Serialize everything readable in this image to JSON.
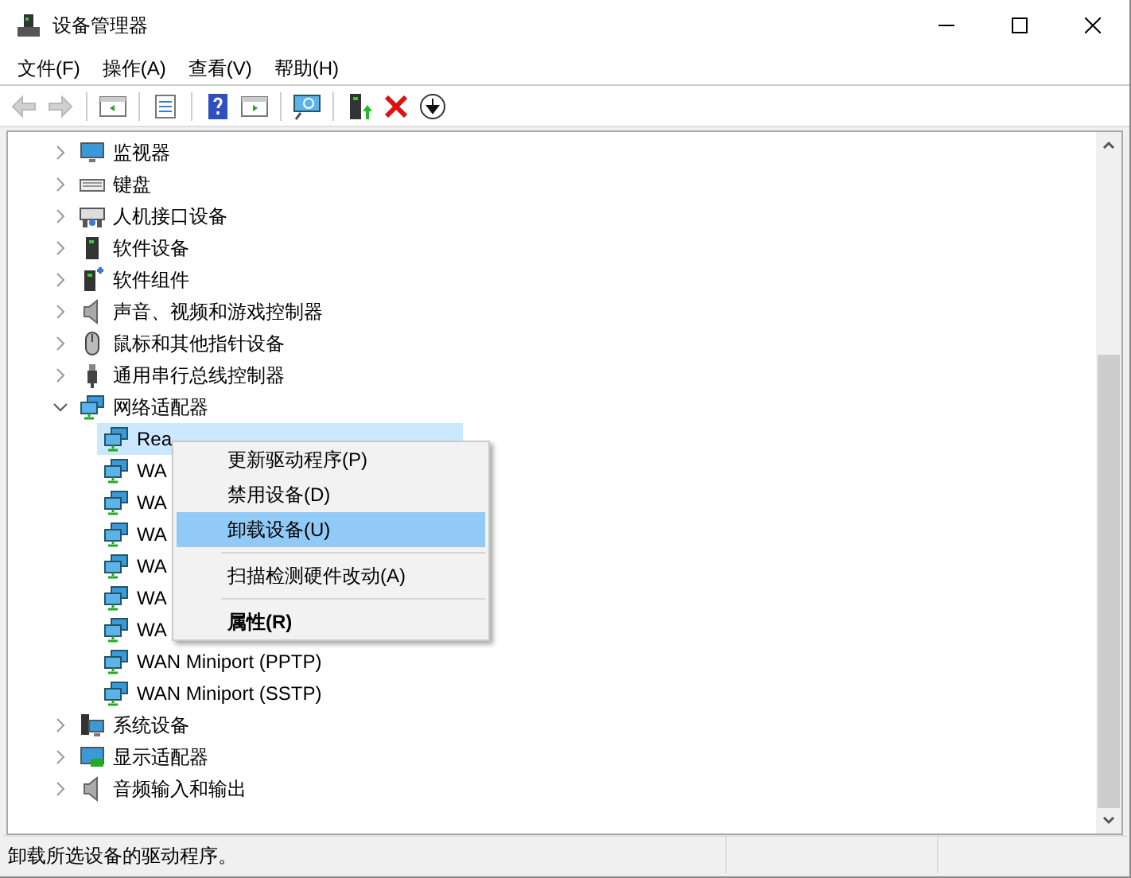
{
  "window": {
    "title": "设备管理器",
    "controls": [
      {
        "kind": "minimize"
      },
      {
        "kind": "maximize"
      },
      {
        "kind": "close"
      }
    ]
  },
  "menu_bar": [
    "文件(F)",
    "操作(A)",
    "查看(V)",
    "帮助(H)"
  ],
  "toolbar": [
    {
      "kind": "back",
      "disabled": true
    },
    {
      "kind": "forward",
      "disabled": true
    },
    {
      "kind": "sep"
    },
    {
      "kind": "panel",
      "disabled": false
    },
    {
      "kind": "sep"
    },
    {
      "kind": "properties",
      "disabled": false
    },
    {
      "kind": "sep"
    },
    {
      "kind": "help",
      "disabled": false
    },
    {
      "kind": "panel2",
      "disabled": false
    },
    {
      "kind": "sep"
    },
    {
      "kind": "scan",
      "disabled": false
    },
    {
      "kind": "sep"
    },
    {
      "kind": "update",
      "disabled": false
    },
    {
      "kind": "uninstall",
      "disabled": false
    },
    {
      "kind": "download",
      "disabled": false
    }
  ],
  "tree": [
    {
      "label": "监视器",
      "kind": "monitor",
      "expanded": false
    },
    {
      "label": "键盘",
      "kind": "keyboard",
      "expanded": false
    },
    {
      "label": "人机接口设备",
      "kind": "hid",
      "expanded": false
    },
    {
      "label": "软件设备",
      "kind": "software",
      "expanded": false
    },
    {
      "label": "软件组件",
      "kind": "component",
      "expanded": false
    },
    {
      "label": "声音、视频和游戏控制器",
      "kind": "speaker",
      "expanded": false
    },
    {
      "label": "鼠标和其他指针设备",
      "kind": "mouse",
      "expanded": false
    },
    {
      "label": "通用串行总线控制器",
      "kind": "usb",
      "expanded": false
    },
    {
      "label": "网络适配器",
      "kind": "network",
      "expanded": true,
      "children": [
        {
          "label": "Rea",
          "kind": "network",
          "selected": true
        },
        {
          "label": "WA",
          "kind": "network",
          "selected": false
        },
        {
          "label": "WA",
          "kind": "network",
          "selected": false
        },
        {
          "label": "WA",
          "kind": "network",
          "selected": false
        },
        {
          "label": "WA",
          "kind": "network",
          "selected": false
        },
        {
          "label": "WA",
          "kind": "network",
          "selected": false
        },
        {
          "label": "WA",
          "kind": "network",
          "selected": false
        },
        {
          "label": "WAN Miniport (PPTP)",
          "kind": "network",
          "selected": false
        },
        {
          "label": "WAN Miniport (SSTP)",
          "kind": "network",
          "selected": false
        }
      ]
    },
    {
      "label": "系统设备",
      "kind": "system",
      "expanded": false
    },
    {
      "label": "显示适配器",
      "kind": "display",
      "expanded": false
    },
    {
      "label": "音频输入和输出",
      "kind": "speaker",
      "expanded": false
    }
  ],
  "context_menu": [
    {
      "kind": "item",
      "label": "更新驱动程序(P)",
      "selected": false,
      "bold": false
    },
    {
      "kind": "item",
      "label": "禁用设备(D)",
      "selected": false,
      "bold": false
    },
    {
      "kind": "item",
      "label": "卸载设备(U)",
      "selected": true,
      "bold": false
    },
    {
      "kind": "sep"
    },
    {
      "kind": "item",
      "label": "扫描检测硬件改动(A)",
      "selected": false,
      "bold": false
    },
    {
      "kind": "sep"
    },
    {
      "kind": "item",
      "label": "属性(R)",
      "selected": false,
      "bold": true
    }
  ],
  "status_bar": {
    "text": "卸载所选设备的驱动程序。"
  }
}
